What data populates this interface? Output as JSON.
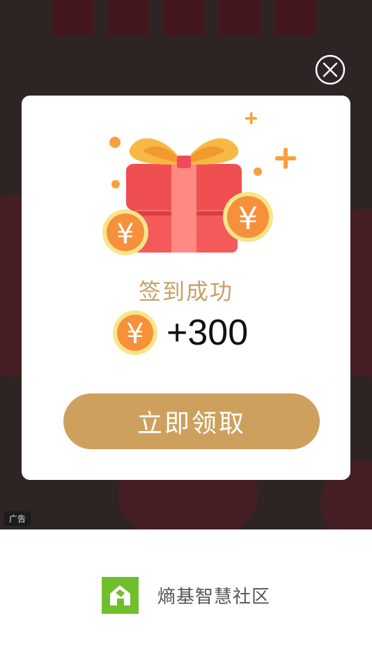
{
  "ad": {
    "tag_label": "广告"
  },
  "modal": {
    "success_title": "签到成功",
    "reward_amount": "+300",
    "claim_button_label": "立即领取",
    "close_icon": "close-circle-icon",
    "gift_icon": "gift-box-icon",
    "coin_icon": "yuan-coin-icon"
  },
  "footer": {
    "app_name": "熵基智慧社区",
    "logo_icon": "house-logo-icon"
  },
  "colors": {
    "accent_gold": "#cda15d",
    "title_gold": "#c9a063",
    "gift_red": "#f05454",
    "coin_orange": "#f7a13a",
    "logo_green": "#6fbf2c"
  }
}
